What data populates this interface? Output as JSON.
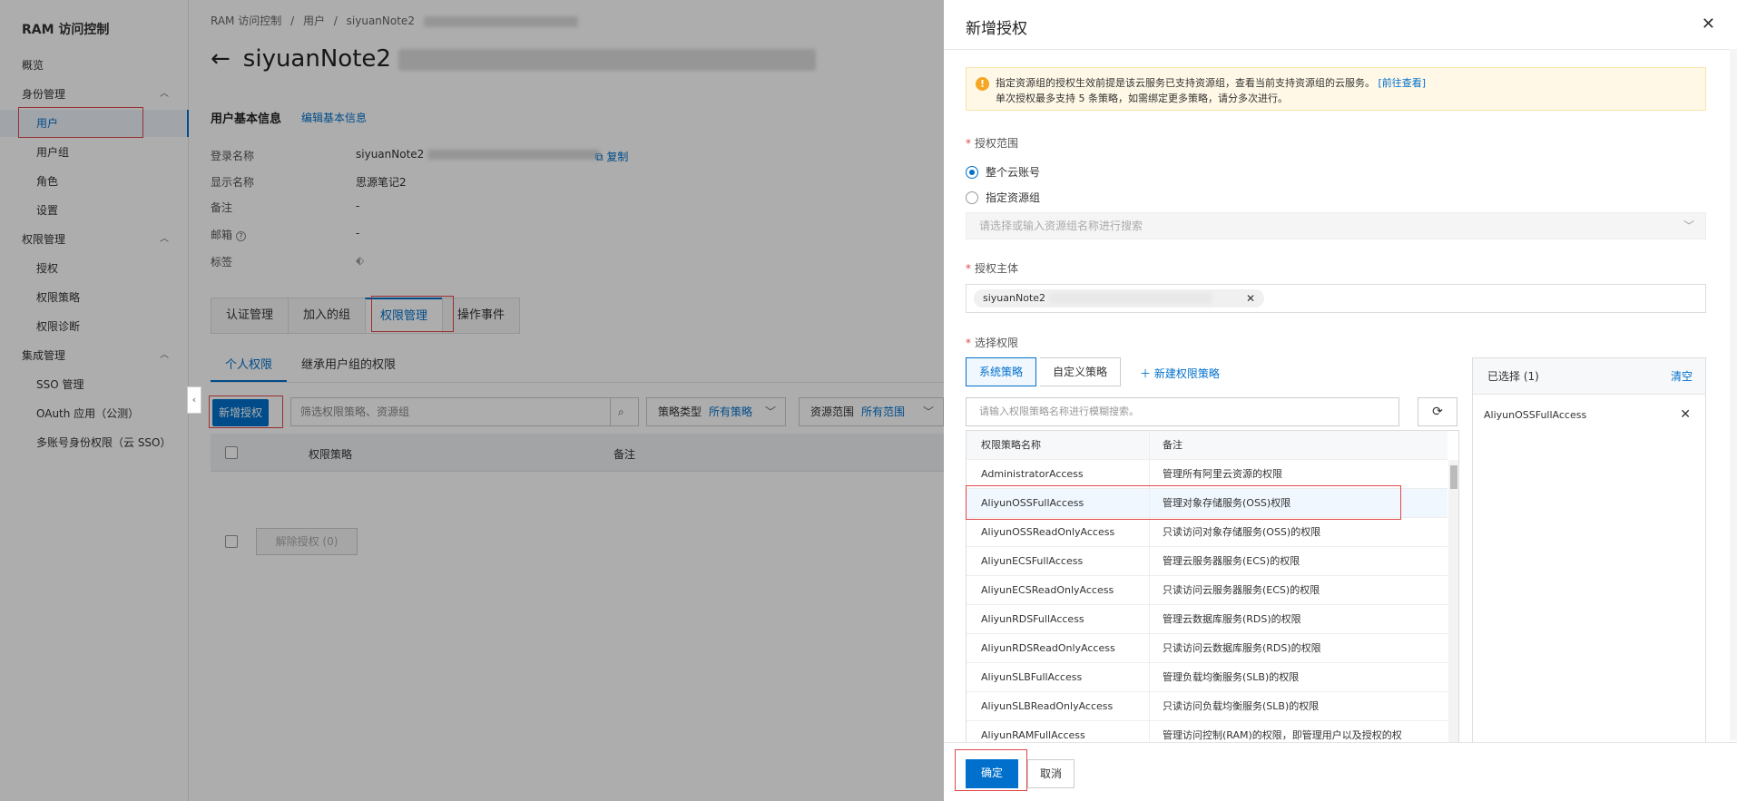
{
  "sidebar": {
    "title": "RAM 访问控制",
    "items": [
      {
        "label": "概览"
      },
      {
        "label": "身份管理"
      },
      {
        "label": "用户"
      },
      {
        "label": "用户组"
      },
      {
        "label": "角色"
      },
      {
        "label": "设置"
      },
      {
        "label": "权限管理"
      },
      {
        "label": "授权"
      },
      {
        "label": "权限策略"
      },
      {
        "label": "权限诊断"
      },
      {
        "label": "集成管理"
      },
      {
        "label": "SSO 管理"
      },
      {
        "label": "OAuth 应用（公测）"
      },
      {
        "label": "多账号身份权限（云 SSO）"
      }
    ]
  },
  "main": {
    "breadcrumb": [
      "RAM 访问控制",
      "/",
      "用户",
      "/",
      "siyuanNote2"
    ],
    "user_name": "siyuanNote2",
    "basic_info_title": "用户基本信息",
    "edit_basic_info": "编辑基本信息",
    "info": {
      "login_label": "登录名称",
      "login_value": "siyuanNote2",
      "copy": "复制",
      "display_label": "显示名称",
      "display_value": "思源笔记2",
      "remark_label": "备注",
      "remark_value": "-",
      "email_label": "邮箱",
      "email_value": "-",
      "tag_label": "标签"
    },
    "tabs": [
      "认证管理",
      "加入的组",
      "权限管理",
      "操作事件"
    ],
    "subtabs": [
      "个人权限",
      "继承用户组的权限"
    ],
    "toolbar": {
      "add_grant": "新增授权",
      "filter_placeholder": "筛选权限策略、资源组",
      "policy_type_label": "策略类型",
      "policy_type_value": "所有策略",
      "scope_label": "资源范围",
      "scope_value": "所有范围"
    },
    "table_headers": [
      "权限策略",
      "备注"
    ],
    "revoke": "解除授权 (0)"
  },
  "drawer": {
    "title": "新增授权",
    "alert_line1": "指定资源组的授权生效前提是该云服务已支持资源组，查看当前支持资源组的云服务。",
    "alert_link": "[前往查看]",
    "alert_line2": "单次授权最多支持 5 条策略，如需绑定更多策略，请分多次进行。",
    "scope_label": "授权范围",
    "scope_options": [
      "整个云账号",
      "指定资源组"
    ],
    "resource_group_placeholder": "请选择或输入资源组名称进行搜索",
    "principal_label": "授权主体",
    "principal_value": "siyuanNote2",
    "select_policy_label": "选择权限",
    "policy_tabs": [
      "系统策略",
      "自定义策略"
    ],
    "new_policy": "新建权限策略",
    "policy_search_placeholder": "请输入权限策略名称进行模糊搜索。",
    "policy_headers": [
      "权限策略名称",
      "备注"
    ],
    "policies": [
      {
        "name": "AdministratorAccess",
        "remark": "管理所有阿里云资源的权限"
      },
      {
        "name": "AliyunOSSFullAccess",
        "remark": "管理对象存储服务(OSS)权限"
      },
      {
        "name": "AliyunOSSReadOnlyAccess",
        "remark": "只读访问对象存储服务(OSS)的权限"
      },
      {
        "name": "AliyunECSFullAccess",
        "remark": "管理云服务器服务(ECS)的权限"
      },
      {
        "name": "AliyunECSReadOnlyAccess",
        "remark": "只读访问云服务器服务(ECS)的权限"
      },
      {
        "name": "AliyunRDSFullAccess",
        "remark": "管理云数据库服务(RDS)的权限"
      },
      {
        "name": "AliyunRDSReadOnlyAccess",
        "remark": "只读访问云数据库服务(RDS)的权限"
      },
      {
        "name": "AliyunSLBFullAccess",
        "remark": "管理负载均衡服务(SLB)的权限"
      },
      {
        "name": "AliyunSLBReadOnlyAccess",
        "remark": "只读访问负载均衡服务(SLB)的权限"
      },
      {
        "name": "AliyunRAMFullAccess",
        "remark": "管理访问控制(RAM)的权限，即管理用户以及授权的权"
      }
    ],
    "chosen_title": "已选择 (1)",
    "clear": "清空",
    "chosen_item": "AliyunOSSFullAccess",
    "confirm": "确定",
    "cancel": "取消"
  },
  "colors": {
    "primary": "#0070cc",
    "highlight": "#e0484a"
  }
}
